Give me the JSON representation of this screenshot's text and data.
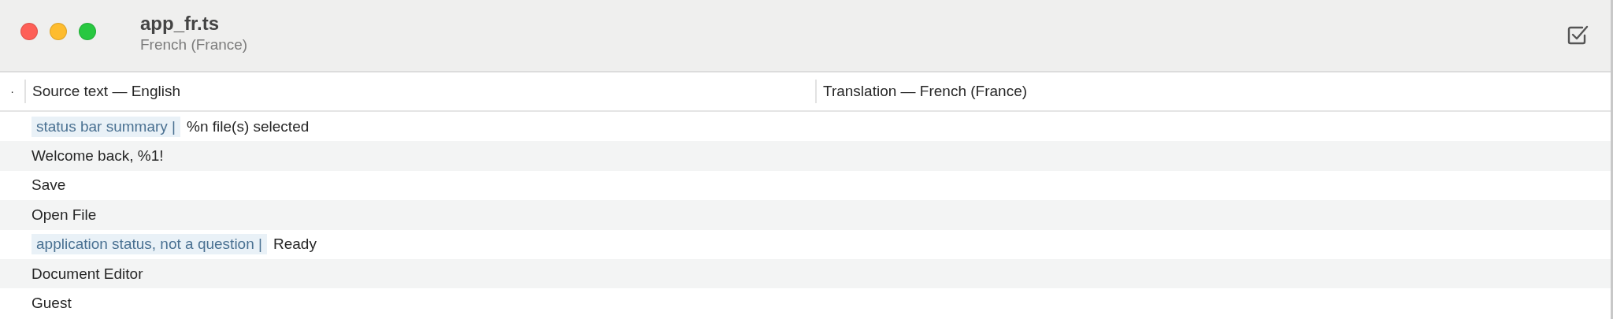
{
  "window": {
    "title": "app_fr.ts",
    "subtitle": "French (France)"
  },
  "table": {
    "marker_column": "·",
    "columns": [
      "Source text — English",
      "Translation — French (France)"
    ],
    "rows": [
      {
        "comment": "status bar summary |",
        "source": "%n file(s) selected"
      },
      {
        "source": "Welcome back, %1!"
      },
      {
        "source": "Save"
      },
      {
        "source": "Open File"
      },
      {
        "comment": "application status, not a question |",
        "source": "Ready"
      },
      {
        "source": "Document Editor"
      },
      {
        "source": "Guest"
      }
    ]
  }
}
